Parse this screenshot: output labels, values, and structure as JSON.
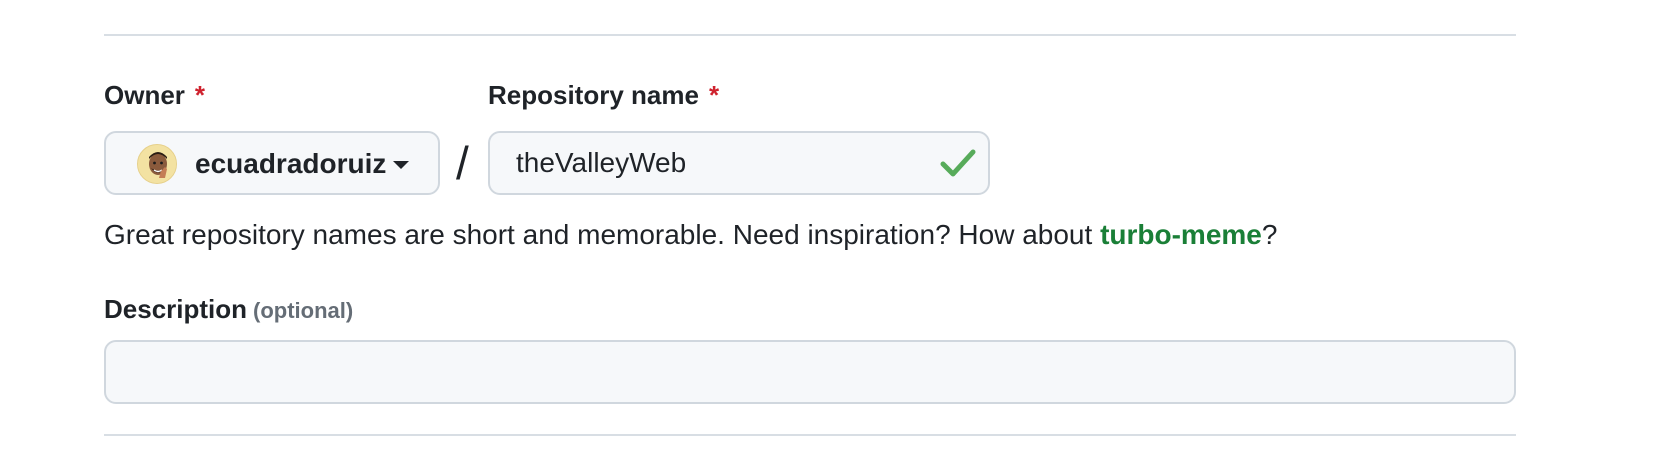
{
  "owner": {
    "label": "Owner",
    "required_mark": "*",
    "selected": "ecuadradoruiz",
    "avatar_bg": "#f3e2a2"
  },
  "separator": "/",
  "repository": {
    "label": "Repository name",
    "required_mark": "*",
    "value": "theValleyWeb",
    "status_icon": "check-icon",
    "status_color": "#57ab5a"
  },
  "hint": {
    "prefix": "Great repository names are short and memorable. Need inspiration? How about ",
    "suggestion": "turbo-meme",
    "suffix": "?"
  },
  "description": {
    "label": "Description",
    "optional_text": "(optional)",
    "value": ""
  },
  "colors": {
    "required": "#cf222e",
    "link": "#1a7f37",
    "border": "#d0d7de",
    "input_bg": "#f6f8fa"
  }
}
